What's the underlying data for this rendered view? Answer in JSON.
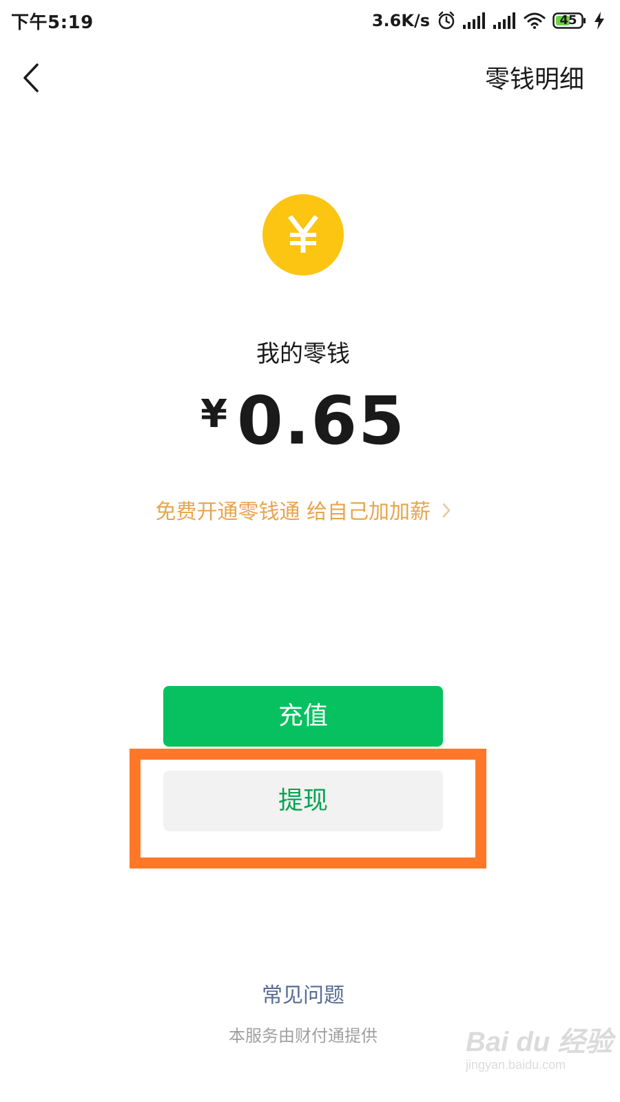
{
  "status_bar": {
    "time": "下午5:19",
    "network_speed": "3.6K/s",
    "battery_level": "45",
    "icons": [
      "alarm-icon",
      "signal-icon",
      "signal-icon",
      "wifi-icon",
      "battery-icon",
      "charging-icon"
    ]
  },
  "header": {
    "back_icon": "chevron-left-icon",
    "details_link": "零钱明细"
  },
  "wallet": {
    "icon": "yuan-coin-icon",
    "label": "我的零钱",
    "currency_symbol": "¥",
    "balance": "0.65",
    "promo_text": "免费开通零钱通 给自己加加薪",
    "promo_icon": "chevron-right-icon"
  },
  "actions": {
    "recharge_label": "充值",
    "withdraw_label": "提现"
  },
  "footer": {
    "faq_link": "常见问题",
    "provider_note": "本服务由财付通提供"
  },
  "watermark": {
    "brand": "Bai du 经验",
    "url": "jingyan.baidu.com"
  },
  "colors": {
    "primary_green": "#07c160",
    "coin_yellow": "#fbc511",
    "promo_orange": "#e8a44c",
    "link_blue": "#576b95",
    "highlight_orange": "#ff7827"
  }
}
